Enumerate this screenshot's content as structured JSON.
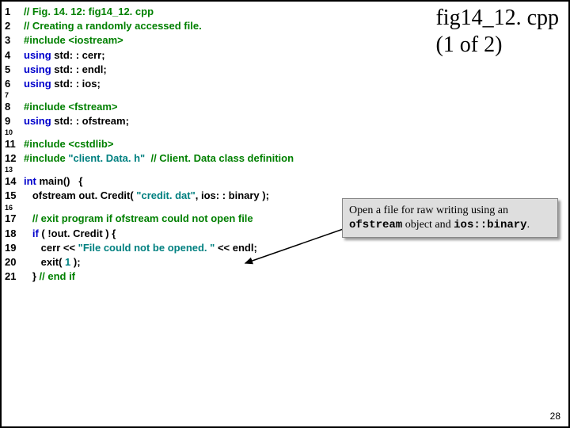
{
  "title": {
    "line1": "fig14_12. cpp",
    "line2": "(1 of 2)"
  },
  "callout": {
    "text_a": "Open a file for raw writing using an ",
    "mono1": "ofstream",
    "text_b": " object and ",
    "mono2": "ios::binary",
    "text_c": "."
  },
  "code": [
    {
      "n": "1",
      "tokens": [
        [
          "c-comment",
          "// Fig. 14. 12: fig14_12. cpp"
        ]
      ]
    },
    {
      "n": "2",
      "tokens": [
        [
          "c-comment",
          "// Creating a randomly accessed file."
        ]
      ]
    },
    {
      "n": "3",
      "tokens": [
        [
          "c-pre",
          "#include <iostream>"
        ]
      ]
    },
    {
      "n": "4",
      "tokens": [
        [
          "c-using",
          "using"
        ],
        [
          "c-plain",
          " std: : cerr;"
        ]
      ]
    },
    {
      "n": "5",
      "tokens": [
        [
          "c-using",
          "using"
        ],
        [
          "c-plain",
          " std: : endl;"
        ]
      ]
    },
    {
      "n": "6",
      "tokens": [
        [
          "c-using",
          "using"
        ],
        [
          "c-plain",
          " std: : ios;"
        ]
      ]
    },
    {
      "n": "7",
      "blank": true
    },
    {
      "n": "8",
      "tokens": [
        [
          "c-pre",
          "#include <fstream>"
        ]
      ]
    },
    {
      "n": "9",
      "tokens": [
        [
          "c-using",
          "using"
        ],
        [
          "c-plain",
          " std: : ofstream;"
        ]
      ]
    },
    {
      "n": "10",
      "blank": true
    },
    {
      "n": "11",
      "tokens": [
        [
          "c-pre",
          "#include <cstdlib>"
        ]
      ]
    },
    {
      "n": "12",
      "tokens": [
        [
          "c-pre",
          "#include "
        ],
        [
          "c-str",
          "\"client. Data. h\""
        ],
        [
          "c-pre",
          "  "
        ],
        [
          "c-comment",
          "// Client. Data class definition"
        ]
      ]
    },
    {
      "n": "13",
      "blank": true
    },
    {
      "n": "14",
      "tokens": [
        [
          "c-kw",
          "int"
        ],
        [
          "c-plain",
          " main()   {"
        ]
      ]
    },
    {
      "n": "15",
      "tokens": [
        [
          "c-plain",
          "   ofstream out. Credit( "
        ],
        [
          "c-str",
          "\"credit. dat\""
        ],
        [
          "c-plain",
          ", ios: : binary );"
        ]
      ]
    },
    {
      "n": "16",
      "blank": true
    },
    {
      "n": "17",
      "tokens": [
        [
          "c-plain",
          "   "
        ],
        [
          "c-comment",
          "// exit program if ofstream could not open file"
        ]
      ]
    },
    {
      "n": "18",
      "tokens": [
        [
          "c-plain",
          "   "
        ],
        [
          "c-kw",
          "if"
        ],
        [
          "c-plain",
          " ( !out. Credit ) {"
        ]
      ]
    },
    {
      "n": "19",
      "tokens": [
        [
          "c-plain",
          "      cerr << "
        ],
        [
          "c-str",
          "\"File could not be opened. \""
        ],
        [
          "c-plain",
          " << endl;"
        ]
      ]
    },
    {
      "n": "20",
      "tokens": [
        [
          "c-plain",
          "      exit( "
        ],
        [
          "c-num",
          "1"
        ],
        [
          "c-plain",
          " );"
        ]
      ]
    },
    {
      "n": "21",
      "tokens": [
        [
          "c-plain",
          "   } "
        ],
        [
          "c-comment",
          "// end if"
        ]
      ]
    }
  ],
  "pagenum": "28"
}
